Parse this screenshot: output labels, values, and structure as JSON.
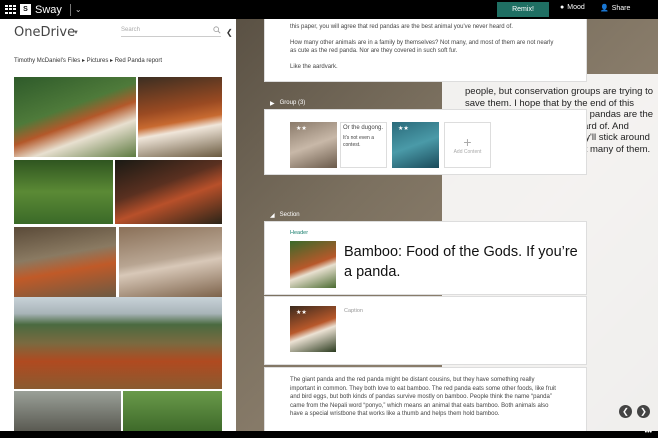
{
  "topbar": {
    "app_name": "Sway",
    "remix_label": "Remix!",
    "mood_label": "Mood",
    "share_label": "Share"
  },
  "left_panel": {
    "title": "OneDrive",
    "search_placeholder": "Search",
    "breadcrumb": [
      "Timothy McDaniel's Files",
      "Pictures",
      "Red Panda report"
    ],
    "breadcrumb_sep": "▸"
  },
  "canvas": {
    "top_card": {
      "p1": "this paper, you will agree that red pandas are the best animal you've never heard of.",
      "p2": "How many other animals are in a family by themselves? Not many, and most of them are not nearly as cute as the red panda. Nor are they covered in such soft fur.",
      "link": "Like the aardvark."
    },
    "group": {
      "label": "Group (3)",
      "text1": "Or the dugong.",
      "text2": "It's not even a contest.",
      "add_label": "Add Content"
    },
    "section": {
      "label": "Section",
      "header_label": "Header",
      "header_text": "Bamboo: Food of the Gods. If you’re a panda.",
      "caption_label": "Caption",
      "body": "The giant panda and the red panda might be distant cousins, but they have something really important in common. They both love to eat bamboo. The red panda eats some other foods, like fruit and bird eggs, but both kinds of pandas survive mostly on bamboo. People think the name “panda” came from the Nepali word “ponyo,” which means an animal that eats bamboo. Both animals also have a special wristbone that works like a thumb and helps them hold bamboo."
    },
    "right_text": "people, but conservation groups are trying to save them. I hope that by the end of this paper, you will agree that red pandas are the best animal you've never heard of. And hopefully, if they're lucky, they'll stick around for a long time. There are not many of them."
  },
  "colors": {
    "accent": "#1f6f63",
    "topbar": "#000000"
  }
}
